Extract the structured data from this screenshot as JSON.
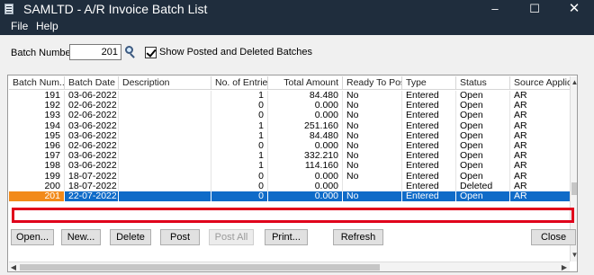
{
  "window": {
    "title": "SAMLTD - A/R Invoice Batch List",
    "controls": {
      "minimize": "–",
      "maximize": "☐",
      "close": "✕"
    }
  },
  "menu": {
    "file": "File",
    "help": "Help"
  },
  "filters": {
    "batch_number_label": "Batch Number",
    "batch_number_value": "201",
    "show_posted_label": "Show Posted and Deleted Batches",
    "show_posted_checked": true
  },
  "grid": {
    "columns": [
      "Batch Num...",
      "Batch Date",
      "Description",
      "No. of Entries",
      "Total Amount",
      "Ready To Post",
      "Type",
      "Status",
      "Source Applicatio"
    ],
    "rows": [
      {
        "batch": "191",
        "date": "03-06-2022",
        "description": "",
        "entries": "1",
        "amount": "84.480",
        "ready": "No",
        "type": "Entered",
        "status": "Open",
        "source": "AR"
      },
      {
        "batch": "192",
        "date": "02-06-2022",
        "description": "",
        "entries": "0",
        "amount": "0.000",
        "ready": "No",
        "type": "Entered",
        "status": "Open",
        "source": "AR"
      },
      {
        "batch": "193",
        "date": "02-06-2022",
        "description": "",
        "entries": "0",
        "amount": "0.000",
        "ready": "No",
        "type": "Entered",
        "status": "Open",
        "source": "AR"
      },
      {
        "batch": "194",
        "date": "03-06-2022",
        "description": "",
        "entries": "1",
        "amount": "251.160",
        "ready": "No",
        "type": "Entered",
        "status": "Open",
        "source": "AR"
      },
      {
        "batch": "195",
        "date": "03-06-2022",
        "description": "",
        "entries": "1",
        "amount": "84.480",
        "ready": "No",
        "type": "Entered",
        "status": "Open",
        "source": "AR"
      },
      {
        "batch": "196",
        "date": "02-06-2022",
        "description": "",
        "entries": "0",
        "amount": "0.000",
        "ready": "No",
        "type": "Entered",
        "status": "Open",
        "source": "AR"
      },
      {
        "batch": "197",
        "date": "03-06-2022",
        "description": "",
        "entries": "1",
        "amount": "332.210",
        "ready": "No",
        "type": "Entered",
        "status": "Open",
        "source": "AR"
      },
      {
        "batch": "198",
        "date": "03-06-2022",
        "description": "",
        "entries": "1",
        "amount": "114.160",
        "ready": "No",
        "type": "Entered",
        "status": "Open",
        "source": "AR"
      },
      {
        "batch": "199",
        "date": "18-07-2022",
        "description": "",
        "entries": "0",
        "amount": "0.000",
        "ready": "No",
        "type": "Entered",
        "status": "Open",
        "source": "AR"
      },
      {
        "batch": "200",
        "date": "18-07-2022",
        "description": "",
        "entries": "0",
        "amount": "0.000",
        "ready": "",
        "type": "Entered",
        "status": "Deleted",
        "source": "AR"
      },
      {
        "batch": "201",
        "date": "22-07-2022",
        "description": "",
        "entries": "0",
        "amount": "0.000",
        "ready": "No",
        "type": "Entered",
        "status": "Open",
        "source": "AR",
        "selected": true
      }
    ]
  },
  "buttons": {
    "open": "Open...",
    "new": "New...",
    "delete": "Delete",
    "post": "Post",
    "post_all": "Post All",
    "print": "Print...",
    "refresh": "Refresh",
    "close": "Close"
  },
  "colors": {
    "title_bar": "#1f2d3d",
    "selection": "#0f6bc8",
    "selected_batch_cell": "#f28a1a",
    "highlight_outline": "#e0001b"
  }
}
